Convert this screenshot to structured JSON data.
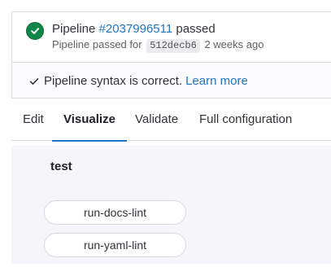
{
  "pipeline": {
    "title_prefix": "Pipeline",
    "id_link": "#2037996511",
    "status_word": "passed",
    "sub_prefix": "Pipeline passed for",
    "commit_sha": "512decb6",
    "time_ago": "2 weeks ago",
    "status_color": "#108548",
    "status_icon": "check-circle-icon"
  },
  "syntax": {
    "message": "Pipeline syntax is correct.",
    "link_label": "Learn more",
    "icon": "check-icon"
  },
  "tabs": [
    {
      "label": "Edit",
      "active": false
    },
    {
      "label": "Visualize",
      "active": true
    },
    {
      "label": "Validate",
      "active": false
    },
    {
      "label": "Full configuration",
      "active": false
    }
  ],
  "visualize": {
    "stage_name": "test",
    "jobs": [
      "run-docs-lint",
      "run-yaml-lint"
    ]
  },
  "colors": {
    "link": "#1f75cb",
    "success": "#108548",
    "active_tab_underline": "#1f75cb"
  }
}
